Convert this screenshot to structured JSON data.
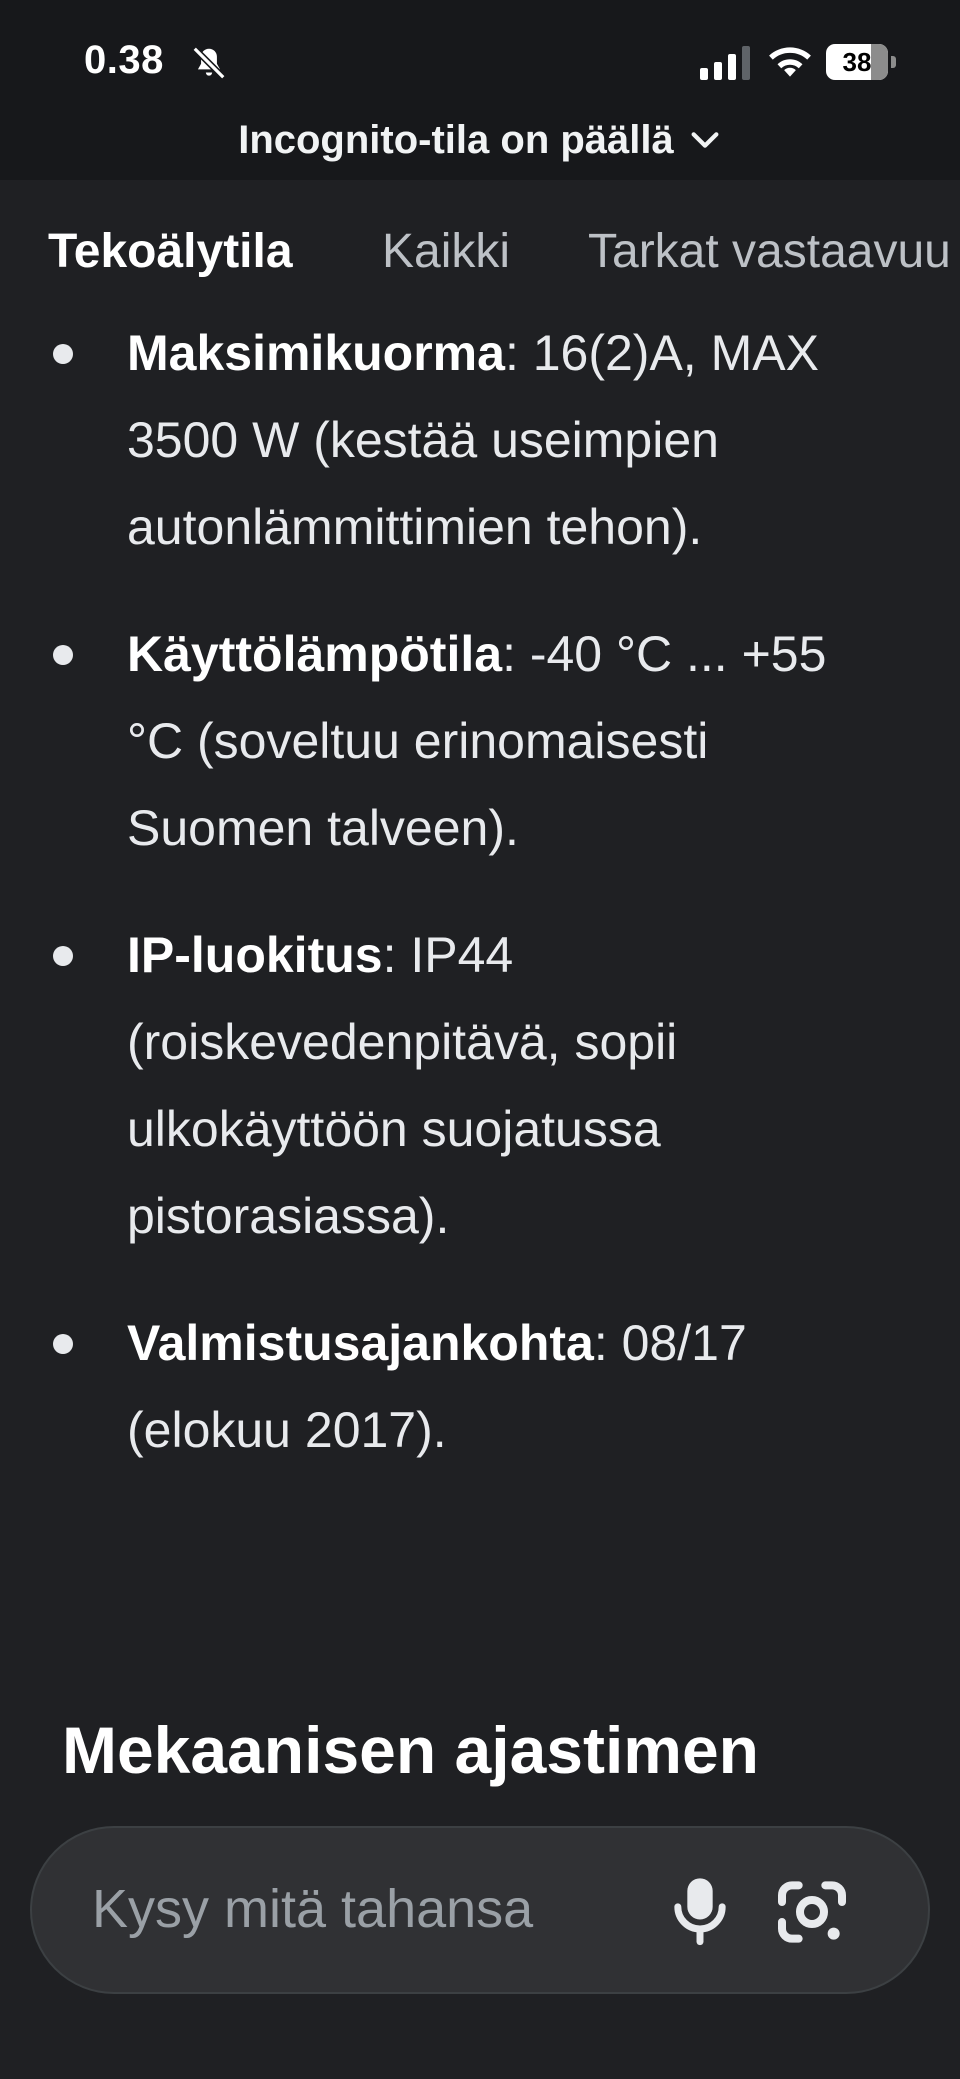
{
  "status_bar": {
    "time": "0.38",
    "battery": "38",
    "battery_fraction": 0.38,
    "icons": [
      "bell-off-icon",
      "signal-icon",
      "wifi-icon",
      "battery-icon"
    ]
  },
  "incognito": {
    "label": "Incognito-tila on päällä",
    "icon": "chevron-down-icon"
  },
  "tabs": [
    {
      "label": "Tekoälytila",
      "active": true
    },
    {
      "label": "Kaikki",
      "active": false
    },
    {
      "label": "Tarkat vastaavuu",
      "active": false
    }
  ],
  "bullets": [
    {
      "term": "Maksimikuorma",
      "text": ": 16(2)A, MAX 3500 W (kestää useimpien autonlämmittimien tehon)."
    },
    {
      "term": "Käyttölämpötila",
      "text": ": -40 °C ... +55 °C (soveltuu erinomaisesti Suomen talveen)."
    },
    {
      "term": "IP-luokitus",
      "text": ": IP44 (roiskevedenpitävä, sopii ulkokäyttöön suojatussa pistorasiassa)."
    },
    {
      "term": "Valmistusajankohta",
      "text": ": 08/17 (elokuu 2017)."
    }
  ],
  "heading": "Mekaanisen ajastimen",
  "search": {
    "placeholder": "Kysy mitä tahansa",
    "icons": [
      "microphone-icon",
      "google-lens-icon"
    ]
  },
  "colors": {
    "background": "#1f2023",
    "top_bar": "#17181b",
    "text": "#e8eaed",
    "muted": "#bdc1c6",
    "search_bar": "#303134"
  }
}
